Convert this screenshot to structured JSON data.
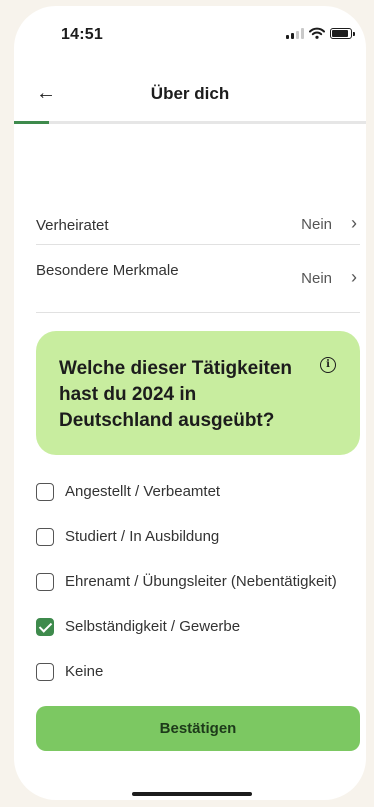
{
  "status_bar": {
    "time": "14:51",
    "icons": [
      "signal-icon",
      "wifi-icon",
      "battery-icon"
    ]
  },
  "header": {
    "back_icon": "←",
    "title": "Über dich"
  },
  "progress": {
    "value": 0.1
  },
  "rows": [
    {
      "label": "Verheiratet",
      "value": "Nein",
      "chevron": "›"
    },
    {
      "label": "Besondere Merkmale",
      "value": "Nein",
      "chevron": "›"
    }
  ],
  "question": {
    "text": "Welche dieser Tätigkeiten hast du 2024 in Deutschland ausgeübt?",
    "info_icon": "i"
  },
  "options": [
    {
      "label": "Angestellt / Verbeamtet",
      "checked": false
    },
    {
      "label": "Studiert / In Ausbildung",
      "checked": false
    },
    {
      "label": "Ehrenamt / Übungsleiter (Nebentätigkeit)",
      "checked": false
    },
    {
      "label": "Selbständigkeit / Gewerbe",
      "checked": true
    },
    {
      "label": "Keine",
      "checked": false
    }
  ],
  "confirm_button": {
    "label": "Bestätigen"
  },
  "colors": {
    "accent": "#3e8a4c",
    "card_background": "#c8ed9f",
    "button_background": "#7cc862",
    "page_background": "#f7f3ec"
  }
}
